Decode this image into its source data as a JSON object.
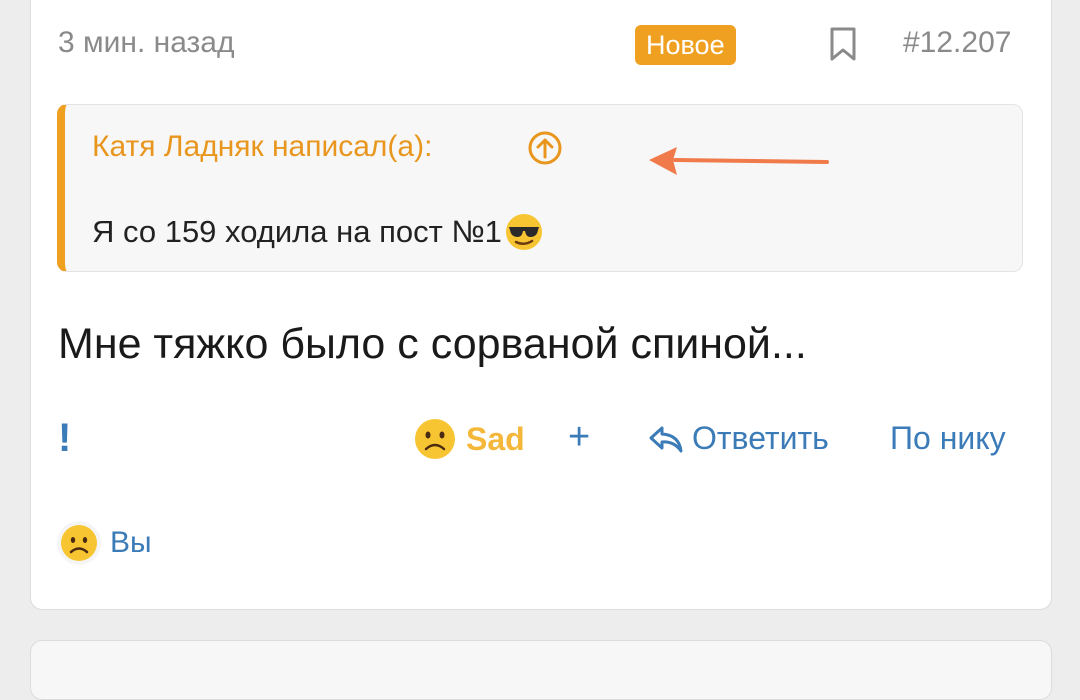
{
  "post": {
    "time": "3 мин. назад",
    "badge": "Новое",
    "number": "#12.207",
    "bookmark_icon": "bookmark-icon",
    "quote": {
      "author": "Катя Ладняк написал(а):",
      "text": "Я со 159 ходила на пост №1",
      "emoji": "sunglasses-emoji"
    },
    "body": "Мне тяжко было с сорваной спиной...",
    "actions": {
      "report": "!",
      "reaction_label": "Sad",
      "add": "+",
      "reply": "Ответить",
      "by_nick": "По нику"
    },
    "reactors": {
      "label": "Вы"
    }
  },
  "colors": {
    "accent": "#f0a020",
    "link": "#3a7bb8",
    "annotation_arrow": "#f07a4a"
  }
}
